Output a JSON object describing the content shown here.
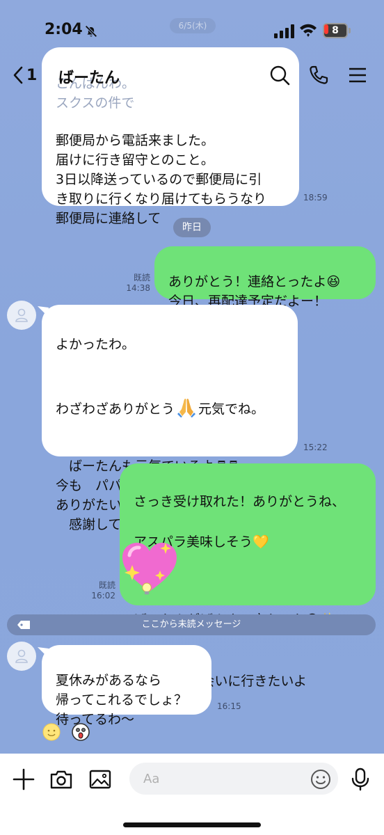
{
  "status_bar": {
    "time": "2:04",
    "battery": "8",
    "date_overlay": "6/5(木)"
  },
  "header": {
    "back_count": "1",
    "title": "ばーたん"
  },
  "messages": {
    "m1": {
      "text_hidden": "こんばんわ。\nスクスの件で",
      "text": "郵便局から電話来ました。\n届けに行き留守とのこと。\n3日以降送っているので郵便局に引\nき取りに行くなり届けてもらうなり\n郵便局に連絡して",
      "time": "18:59"
    },
    "date_separator": "昨日",
    "m2": {
      "text": "ありがとう！連絡とったよ😆\n今日、再配達予定だよー！",
      "read": "既読",
      "time": "14:38"
    },
    "m3": {
      "line1": "よかったわ。",
      "line2a": "わざわざありがとう",
      "line2b": "元気でね。",
      "rest": "\n　ばーたんも元気でいるよ♬♬\n今も　パパが毎日来てくれてるよ。\nありがたいことよ。\n　感謝してるわ。",
      "time": "15:22"
    },
    "m4": {
      "line1": "さっき受け取れた！ありがとうね、",
      "line2": "アスパラ美味しそう💛",
      "line3": "ばーたんがげんきで良かった😁✨",
      "line4": "も、会いに行きたいよ",
      "read": "既読",
      "time": "16:02"
    },
    "unread_label": "ここから未読メッセージ",
    "m5": {
      "text": "夏休みがあるなら\n帰ってこれるでしょ？\n待ってるわ〜",
      "time": "16:15"
    }
  },
  "input": {
    "placeholder": "Aa"
  },
  "colors": {
    "background": "#8ea9dc",
    "outgoing_bubble": "#6fe278",
    "incoming_bubble": "#ffffff"
  }
}
